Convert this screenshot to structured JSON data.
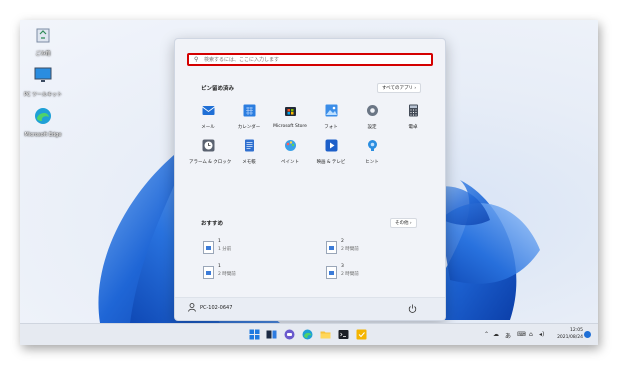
{
  "desktop": {
    "icons": [
      {
        "label": "ごみ箱",
        "icon": "recycle-bin-icon"
      },
      {
        "label": "PC ツールキット",
        "icon": "monitor-icon"
      },
      {
        "label": "Microsoft Edge",
        "icon": "edge-icon"
      }
    ]
  },
  "start_menu": {
    "search_placeholder": "検索するには、ここに入力します",
    "pinned_title": "ピン留め済み",
    "all_apps_label": "すべてのアプリ ›",
    "pinned_apps": [
      {
        "label": "メール",
        "icon": "mail-icon"
      },
      {
        "label": "カレンダー",
        "icon": "calendar-icon"
      },
      {
        "label": "Microsoft Store",
        "icon": "store-icon"
      },
      {
        "label": "フォト",
        "icon": "photos-icon"
      },
      {
        "label": "設定",
        "icon": "settings-icon"
      },
      {
        "label": "電卓",
        "icon": "calculator-icon"
      },
      {
        "label": "アラーム & クロック",
        "icon": "alarm-clock-icon"
      },
      {
        "label": "メモ帳",
        "icon": "notepad-icon"
      },
      {
        "label": "ペイント",
        "icon": "paint-icon"
      },
      {
        "label": "映画 & テレビ",
        "icon": "movies-tv-icon"
      },
      {
        "label": "ヒント",
        "icon": "tips-icon"
      }
    ],
    "recommended_title": "おすすめ",
    "more_label": "その他 ›",
    "recommended": [
      {
        "name": "1",
        "time": "1 分前"
      },
      {
        "name": "2",
        "time": "2 時間前"
      },
      {
        "name": "1",
        "time": "2 時間前"
      },
      {
        "name": "3",
        "time": "2 時間前"
      }
    ],
    "user_name": "PC-102-0647"
  },
  "taskbar": {
    "apps": [
      "start-icon",
      "search-icon",
      "task-view-icon",
      "widgets-icon",
      "chat-icon",
      "edge-icon",
      "file-explorer-icon",
      "terminal-icon",
      "sticky-notes-icon"
    ],
    "tray_text": "あ",
    "time": "12:05",
    "date": "2021/08/24"
  },
  "colors": {
    "accent": "#0067c0",
    "highlight_border": "#d40000"
  }
}
